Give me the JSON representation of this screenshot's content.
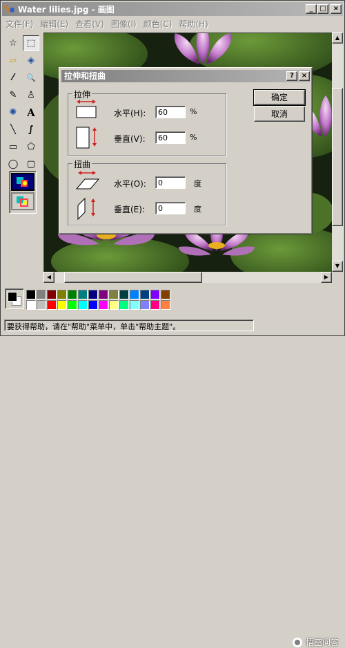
{
  "window": {
    "title": "Water lilies.jpg - 画图",
    "minimize": "_",
    "maximize": "□",
    "close": "×"
  },
  "menu": [
    "文件(F)",
    "编辑(E)",
    "查看(V)",
    "图像(I)",
    "颜色(C)",
    "帮助(H)"
  ],
  "tools": [
    {
      "name": "free-select-icon",
      "glyph": "☆"
    },
    {
      "name": "rect-select-icon",
      "glyph": "⬚"
    },
    {
      "name": "eraser-icon",
      "glyph": "▱"
    },
    {
      "name": "fill-bucket-icon",
      "glyph": "◈"
    },
    {
      "name": "color-picker-icon",
      "glyph": "⁄"
    },
    {
      "name": "magnifier-icon",
      "glyph": "🔍"
    },
    {
      "name": "pencil-icon",
      "glyph": "✎"
    },
    {
      "name": "brush-icon",
      "glyph": "♙"
    },
    {
      "name": "airbrush-icon",
      "glyph": "✺"
    },
    {
      "name": "text-icon",
      "glyph": "A"
    },
    {
      "name": "line-icon",
      "glyph": "╲"
    },
    {
      "name": "curve-icon",
      "glyph": "∫"
    },
    {
      "name": "rectangle-icon",
      "glyph": "▭"
    },
    {
      "name": "polygon-icon",
      "glyph": "⬠"
    },
    {
      "name": "ellipse-icon",
      "glyph": "◯"
    },
    {
      "name": "rounded-rect-icon",
      "glyph": "▢"
    }
  ],
  "dialog": {
    "title": "拉伸和扭曲",
    "help": "?",
    "close": "×",
    "stretch": {
      "label": "拉伸",
      "h_label": "水平(H):",
      "h_value": "60",
      "h_unit": "%",
      "v_label": "垂直(V):",
      "v_value": "60",
      "v_unit": "%"
    },
    "skew": {
      "label": "扭曲",
      "h_label": "水平(O):",
      "h_value": "0",
      "h_unit": "度",
      "v_label": "垂直(E):",
      "v_value": "0",
      "v_unit": "度"
    },
    "ok": "确定",
    "cancel": "取消"
  },
  "palette": {
    "row1": [
      "#000000",
      "#808080",
      "#800000",
      "#808000",
      "#008000",
      "#008080",
      "#000080",
      "#800080",
      "#808040",
      "#004040",
      "#0080ff",
      "#004080",
      "#8000ff",
      "#804000"
    ],
    "row2": [
      "#ffffff",
      "#c0c0c0",
      "#ff0000",
      "#ffff00",
      "#00ff00",
      "#00ffff",
      "#0000ff",
      "#ff00ff",
      "#ffff80",
      "#00ff80",
      "#80ffff",
      "#8080ff",
      "#ff0080",
      "#ff8040"
    ],
    "foreground": "#000000",
    "background": "#ffffff"
  },
  "status": "要获得帮助，请在\"帮助\"菜单中，单击\"帮助主题\"。",
  "watermark": "悟空问答"
}
